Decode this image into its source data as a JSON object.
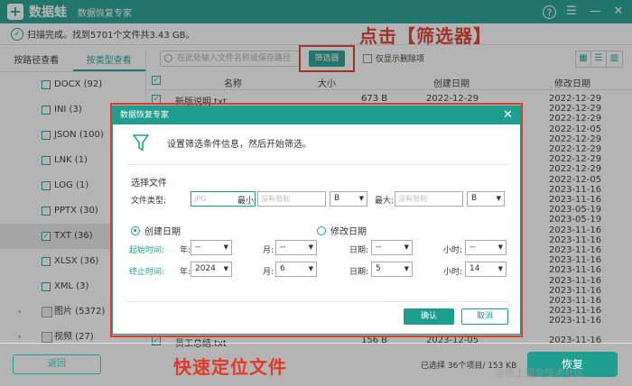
{
  "app": {
    "name": "数据蛙",
    "subtitle": "数据恢复专家",
    "help_label": "?",
    "menu_label": "☰",
    "min_label": "—",
    "close_label": "✕"
  },
  "status": {
    "text": "扫描完成。找到5701个文件共3.43 GB。"
  },
  "annotations": {
    "top": "点击【筛选器】",
    "bottom": "快速定位文件"
  },
  "sidebar": {
    "tabs": [
      "按路径查看",
      "按类型查看"
    ],
    "active_tab": 1,
    "items": [
      {
        "label": "DOCX (92)",
        "checked": false
      },
      {
        "label": "INI (3)",
        "checked": false
      },
      {
        "label": "JSON (100)",
        "checked": false
      },
      {
        "label": "LNK (1)",
        "checked": false
      },
      {
        "label": "LOG (1)",
        "checked": false
      },
      {
        "label": "PPTX (30)",
        "checked": false
      },
      {
        "label": "TXT (36)",
        "checked": true
      },
      {
        "label": "XLSX (36)",
        "checked": false
      },
      {
        "label": "XML (3)",
        "checked": false
      }
    ],
    "groups": [
      {
        "label": "图片 (5372)"
      },
      {
        "label": "视频 (27)"
      }
    ]
  },
  "toolbar": {
    "search_placeholder": "在此处输入文件名称或保存路径",
    "filter_label": "筛选器",
    "show_deleted_label": "仅显示删除项"
  },
  "table": {
    "headers": [
      "名称",
      "大小",
      "创建日期",
      "修改日期"
    ],
    "rows": [
      {
        "name": "新版说明.txt",
        "size": "673  B",
        "created": "2022-12-29",
        "modified": "2022-12-29"
      },
      {
        "name": "",
        "size": "",
        "created": "",
        "modified": "2022-12-29"
      },
      {
        "name": "",
        "size": "",
        "created": "",
        "modified": "2022-12-29"
      },
      {
        "name": "",
        "size": "",
        "created": "",
        "modified": "2022-12-05"
      },
      {
        "name": "",
        "size": "",
        "created": "",
        "modified": "2022-12-29"
      },
      {
        "name": "",
        "size": "",
        "created": "",
        "modified": "2022-12-29"
      },
      {
        "name": "",
        "size": "",
        "created": "",
        "modified": "2022-12-29"
      },
      {
        "name": "",
        "size": "",
        "created": "",
        "modified": "2022-12-29"
      },
      {
        "name": "",
        "size": "",
        "created": "",
        "modified": "2022-12-05"
      },
      {
        "name": "",
        "size": "",
        "created": "",
        "modified": "2023-11-16"
      },
      {
        "name": "",
        "size": "",
        "created": "",
        "modified": "2023-11-16"
      },
      {
        "name": "",
        "size": "",
        "created": "",
        "modified": "2023-05-19"
      },
      {
        "name": "",
        "size": "",
        "created": "",
        "modified": "2023-05-19"
      },
      {
        "name": "",
        "size": "",
        "created": "",
        "modified": "2023-11-16"
      },
      {
        "name": "",
        "size": "",
        "created": "",
        "modified": "2023-11-16"
      },
      {
        "name": "",
        "size": "",
        "created": "",
        "modified": "2023-11-16"
      },
      {
        "name": "",
        "size": "",
        "created": "",
        "modified": "2023-11-16"
      },
      {
        "name": "",
        "size": "",
        "created": "",
        "modified": "2023-11-16"
      },
      {
        "name": "",
        "size": "",
        "created": "",
        "modified": "2023-11-16"
      },
      {
        "name": "",
        "size": "",
        "created": "",
        "modified": "2023-11-16"
      },
      {
        "name": "",
        "size": "",
        "created": "",
        "modified": "2023-11-16"
      },
      {
        "name": "",
        "size": "",
        "created": "",
        "modified": "2023-11-16"
      },
      {
        "name": "",
        "size": "",
        "created": "",
        "modified": "2023-11-16"
      },
      {
        "name": "员工总结.txt",
        "size": "156  B",
        "created": "2023-12-05",
        "modified": "2023-11-16"
      }
    ]
  },
  "dialog": {
    "title": "数据恢复专家",
    "intro": "设置筛选条件信息，然后开始筛选。",
    "section_label": "选择文件",
    "file_type_label": "文件类型:",
    "file_type_placeholder": "JPG",
    "min_label": "最小:",
    "min_placeholder": "没有限制",
    "min_unit": "B",
    "max_label": "最大:",
    "max_placeholder": "没有限制",
    "max_unit": "B",
    "radio_created": "创建日期",
    "radio_modified": "修改日期",
    "start_label": "起始时间:",
    "end_label": "终止时间:",
    "year_label": "年:",
    "month_label": "月:",
    "day_label": "日期:",
    "hour_label": "小时:",
    "start": {
      "year": "--",
      "month": "--",
      "day": "--",
      "hour": "--"
    },
    "end": {
      "year": "2024",
      "month": "6",
      "day": "5",
      "hour": "14"
    },
    "ok_label": "确认",
    "cancel_label": "取消",
    "close_label": "✕"
  },
  "bottom": {
    "back_label": "返回",
    "selected_text": "已选择 36个项目/ 153 KB",
    "restore_label": "恢复"
  },
  "watermark": "@稀土掘金技术社区",
  "colors": {
    "accent": "#1f9e8f",
    "annotation": "#e03a2a"
  }
}
